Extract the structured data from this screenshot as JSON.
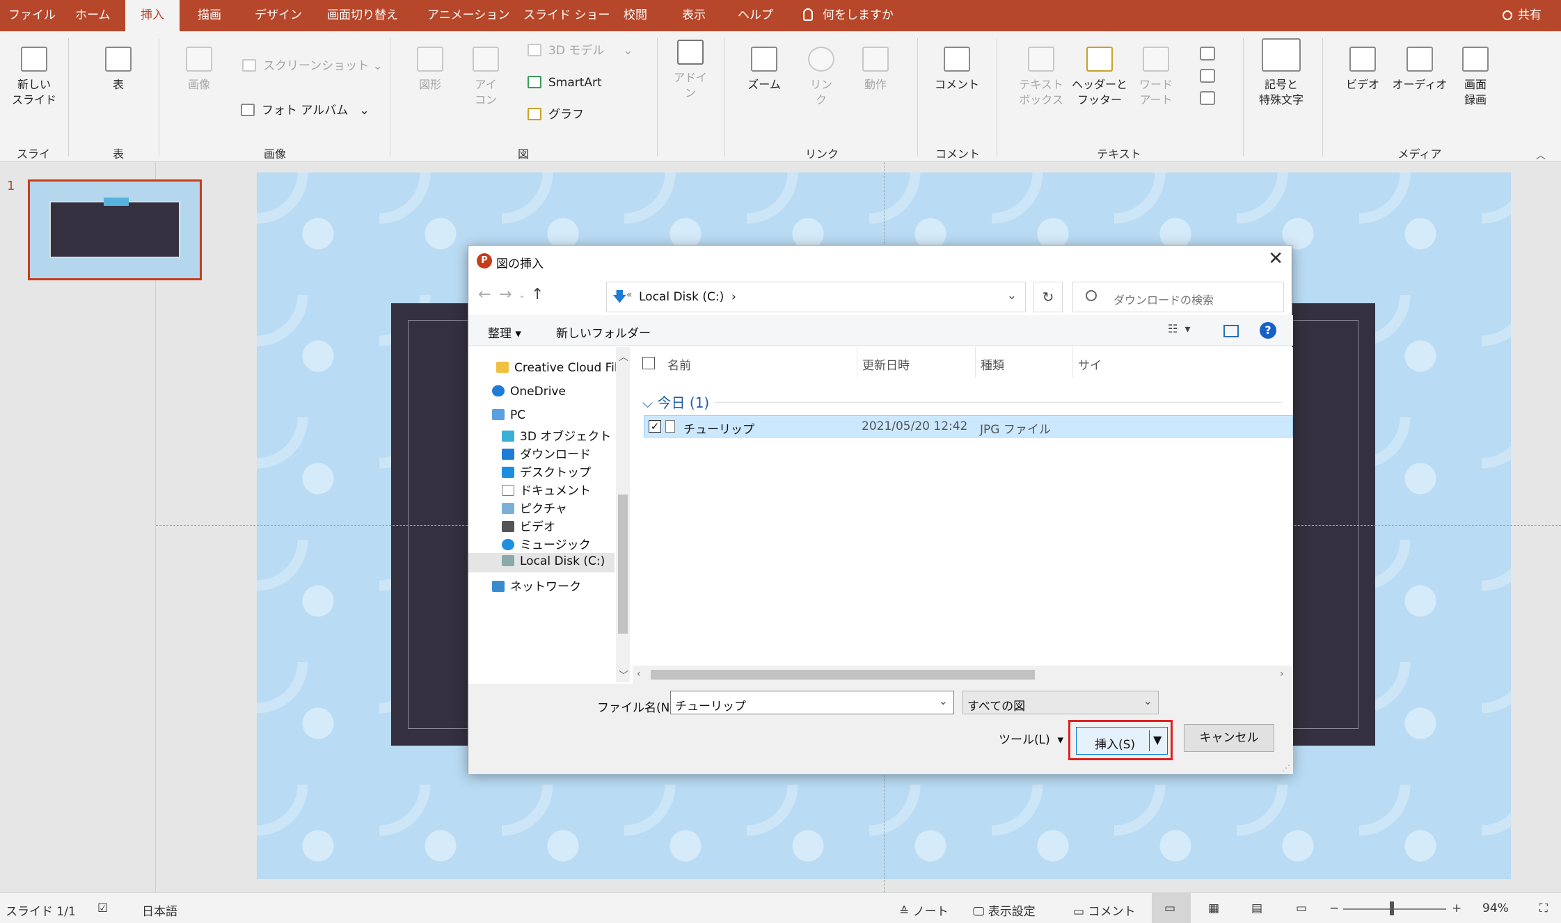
{
  "tabs": [
    "ファイル",
    "ホーム",
    "挿入",
    "描画",
    "デザイン",
    "画面切り替え",
    "アニメーション",
    "スライド ショー",
    "校閲",
    "表示",
    "ヘルプ",
    "何をしますか"
  ],
  "active_tab": "挿入",
  "share_label": "共有",
  "ribbon": {
    "new_slide": "新しい\nスライド",
    "table": "表",
    "image": "画像",
    "screenshot": "スクリーンショット",
    "photo_album": "フォト アルバム",
    "shape": "図形",
    "icon": "アイ\nコン",
    "model3d": "3D モデル",
    "smartart": "SmartArt",
    "graph": "グラフ",
    "addin": "アドイ\nン",
    "zoom": "ズーム",
    "link": "リン\nク",
    "action": "動作",
    "comment": "コメント",
    "textbox": "テキスト\nボックス",
    "header_footer": "ヘッダーと\nフッター",
    "wordart": "ワード\nアート",
    "symbol": "記号と\n特殊文字",
    "video": "ビデオ",
    "audio": "オーディオ",
    "screen_record": "画面\n録画",
    "groups": {
      "slide": "スライド",
      "table": "表",
      "image": "画像",
      "figure": "図",
      "link": "リンク",
      "comment": "コメント",
      "text": "テキスト",
      "media": "メディア"
    }
  },
  "thumbnail": {
    "number": "1"
  },
  "dialog": {
    "title": "図の挿入",
    "address": "Local Disk (C:)",
    "search_placeholder": "ダウンロードの検索",
    "toolbar": {
      "organize": "整理",
      "new_folder": "新しいフォルダー"
    },
    "tree": [
      "Creative Cloud File",
      "OneDrive",
      "PC",
      "3D オブジェクト",
      "ダウンロード",
      "デスクトップ",
      "ドキュメント",
      "ピクチャ",
      "ビデオ",
      "ミュージック",
      "Local Disk (C:)",
      "ネットワーク"
    ],
    "columns": {
      "name": "名前",
      "modified": "更新日時",
      "type": "種類",
      "size": "サイ"
    },
    "group": "今日 (1)",
    "file": {
      "name": "チューリップ",
      "modified": "2021/05/20 12:42",
      "type": "JPG ファイル"
    },
    "filename_label": "ファイル名(N):",
    "filename_value": "チューリップ",
    "filter": "すべての図",
    "tools": "ツール(L)",
    "insert": "挿入(S)",
    "cancel": "キャンセル"
  },
  "status": {
    "slide": "スライド 1/1",
    "lang": "日本語",
    "notes": "ノート",
    "display": "表示設定",
    "comment": "コメント",
    "zoom": "94%"
  }
}
